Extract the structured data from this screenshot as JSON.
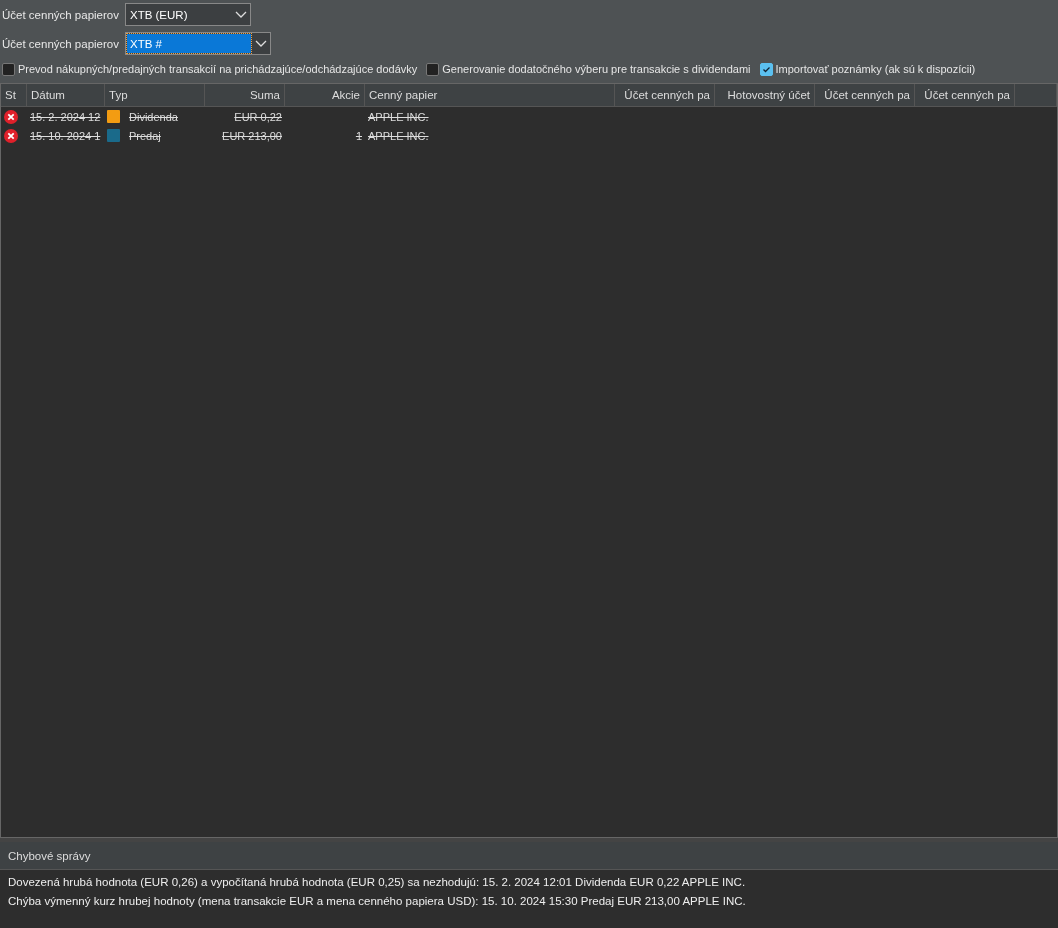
{
  "account_selectors": [
    {
      "label": "Účet cenných papierov",
      "value": "XTB (EUR)",
      "focused": false
    },
    {
      "label": "Účet cenných papierov",
      "value": "XTB #",
      "focused": true
    }
  ],
  "options": [
    {
      "label": "Prevod nákupných/predajných transakcií na prichádzajúce/odchádzajúce dodávky",
      "checked": false
    },
    {
      "label": "Generovanie dodatočného výberu pre transakcie s dividendami",
      "checked": false
    },
    {
      "label": "Importovať poznámky (ak sú k dispozícii)",
      "checked": true
    }
  ],
  "table": {
    "columns": [
      "St",
      "Dátum",
      "Typ",
      "Suma",
      "Akcie",
      "Cenný papier",
      "Účet cenných pa",
      "Hotovostný účet",
      "Účet cenných pa",
      "Účet cenných pa"
    ],
    "rows": [
      {
        "kind": "error",
        "date": "15. 2. 2024 12",
        "type": "Dividenda",
        "color": "#f39c12",
        "amount": "EUR 0,22",
        "security": "APPLE INC.",
        "struck": true
      },
      {
        "kind": "error",
        "date": "15. 10. 2024 1",
        "type": "Predaj",
        "color": "#1a6a8a",
        "amount": "EUR 213,00",
        "shares": "1",
        "security": "APPLE INC.",
        "struck": true
      }
    ]
  },
  "errors": {
    "title": "Chybové správy",
    "messages": [
      "Dovezená hrubá hodnota (EUR 0,26) a vypočítaná hrubá hodnota (EUR 0,25) sa nezhodujú: 15. 2. 2024 12:01 Dividenda EUR 0,22 APPLE INC.",
      "Chýba výmenný kurz hrubej hodnoty (mena transakcie EUR a mena cenného papiera USD): 15. 10. 2024 15:30 Predaj EUR 213,00 APPLE INC."
    ]
  }
}
